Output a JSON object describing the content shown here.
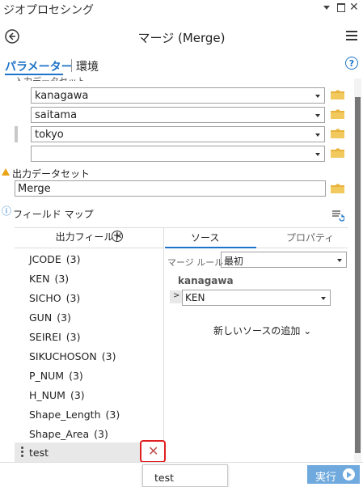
{
  "app": {
    "title": "ジオプロセシング"
  },
  "header": {
    "tool_title": "マージ (Merge)"
  },
  "tabs": {
    "parameters": "パラメーター",
    "environments": "環境",
    "help": "?"
  },
  "input_datasets": {
    "label": "入力データセット",
    "items": [
      {
        "value": "kanagawa"
      },
      {
        "value": "saitama"
      },
      {
        "value": "tokyo"
      },
      {
        "value": ""
      }
    ]
  },
  "output": {
    "label": "出力データセット",
    "value": "Merge"
  },
  "field_map": {
    "label": "フィールド マップ",
    "output_fields_header": "出力フィールド",
    "add_symbol": "+",
    "fields": [
      {
        "name": "JCODE",
        "count": "(3)"
      },
      {
        "name": "KEN",
        "count": "(3)"
      },
      {
        "name": "SICHO",
        "count": "(3)"
      },
      {
        "name": "GUN",
        "count": "(3)"
      },
      {
        "name": "SEIREI",
        "count": "(3)"
      },
      {
        "name": "SIKUCHOSON",
        "count": "(3)"
      },
      {
        "name": "P_NUM",
        "count": "(3)"
      },
      {
        "name": "H_NUM",
        "count": "(3)"
      },
      {
        "name": "Shape_Length",
        "count": "(3)"
      },
      {
        "name": "Shape_Area",
        "count": "(3)"
      }
    ],
    "selected_field": "test",
    "delete_symbol": "✕",
    "tabs": {
      "sources": "ソース",
      "properties": "プロパティ"
    },
    "merge_rule_label": "マージ ルール",
    "merge_rule_value": "最初",
    "source_name": "kanagawa",
    "source_field": "KEN",
    "expand_symbol": ">",
    "add_source": "新しいソースの追加 ⌄"
  },
  "popup": {
    "item": "test"
  },
  "run": {
    "label": "実行"
  },
  "colors": {
    "accent": "#1e74c8",
    "run_button": "#6fa9dd",
    "delete_highlight": "#e02020",
    "folder": "#e8b33c"
  }
}
